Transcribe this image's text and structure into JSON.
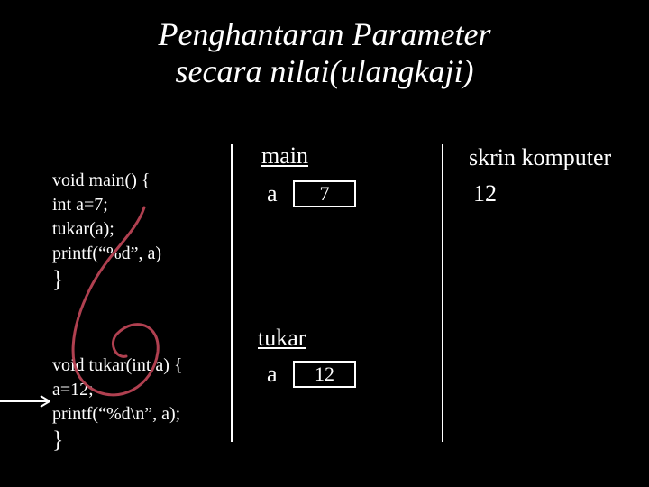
{
  "title_line1": "Penghantaran Parameter",
  "title_line2": "secara nilai(ulangkaji)",
  "code_main": {
    "l1": "void main() {",
    "l2": "int a=7;",
    "l3": "tukar(a);",
    "l4": "printf(“%d”, a)",
    "l5": "}"
  },
  "code_tukar": {
    "l1": "void tukar(int a) {",
    "l2": "a=12;",
    "l3": "printf(“%d\\n”, a);",
    "l4": "}"
  },
  "sections": {
    "main": "main",
    "tukar": "tukar",
    "screen": "skrin komputer"
  },
  "vars": {
    "a": "a"
  },
  "values": {
    "main_a": "7",
    "tukar_a": "12",
    "output": "12"
  }
}
